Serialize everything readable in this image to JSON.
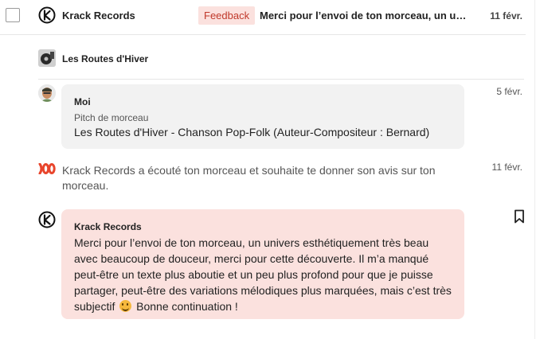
{
  "thread_row": {
    "sender": "Krack Records",
    "tag": "Feedback",
    "subject": "Merci pour l’envoi de ton morceau, un univers esthétiquement très beau avec beaucoup de douceur, merci pour cette découverte.",
    "date": "11 févr."
  },
  "project": {
    "title": "Les Routes d'Hiver"
  },
  "message_pitch": {
    "sender": "Moi",
    "subtitle": "Pitch de morceau",
    "track": "Les Routes d'Hiver - Chanson Pop-Folk (Auteur-Compositeur : Bernard)",
    "date": "5 févr."
  },
  "notification": {
    "text": "Krack Records a écouté ton morceau et souhaite te donner son avis sur ton morceau.",
    "date": "11 févr."
  },
  "message_feedback": {
    "sender": "Krack Records",
    "body_before_emoji": "Merci pour l’envoi de ton morceau, un univers esthétiquement très beau avec beaucoup de douceur, merci pour cette découverte. Il m’a manqué peut-être un texte plus aboutie et un peu plus profond pour que je puisse partager, peut-être des variations mélodiques plus marquées, mais c’est très subjectif",
    "body_after_emoji": "Bonne continuation !"
  },
  "colors": {
    "tag_bg": "#fbe1de",
    "tag_text": "#c0392b",
    "feedback_bubble": "#fbe1de",
    "pitch_bubble": "#f2f2f2",
    "notification_icon": "#e8452c"
  },
  "icons": {
    "checkbox": "checkbox-icon",
    "label_logo": "krack-records-logo",
    "project_cover": "album-cover-thumbnail",
    "user_avatar": "user-avatar",
    "notification": "listen-waves-icon",
    "bookmark": "bookmark-icon"
  }
}
